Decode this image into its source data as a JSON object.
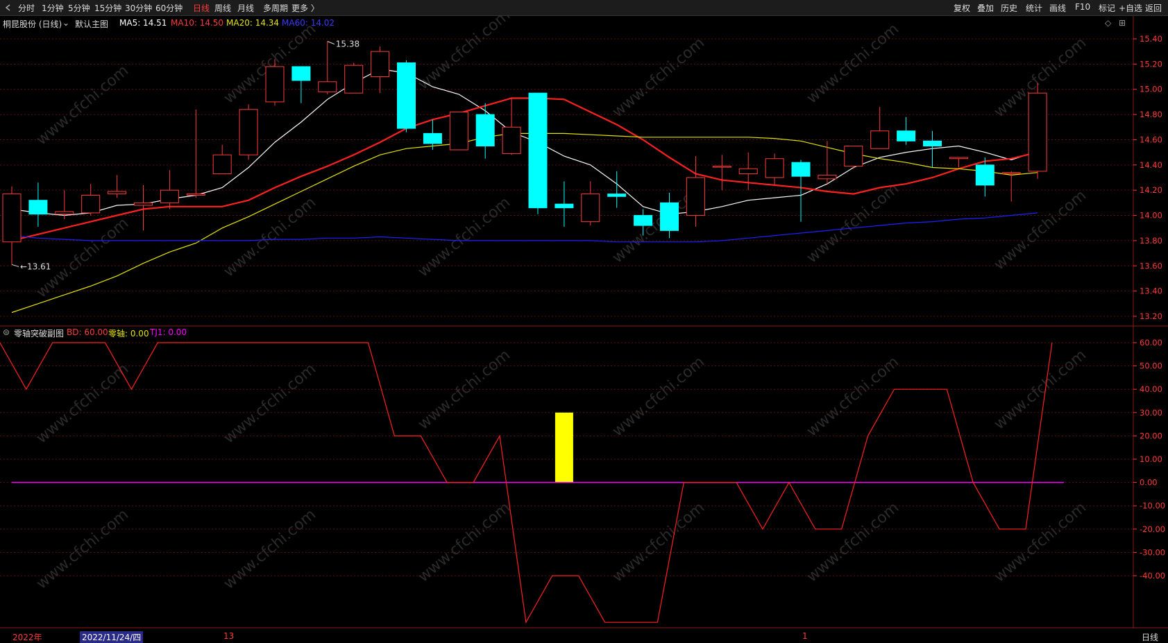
{
  "toolbar": {
    "left_items": [
      {
        "label": "分时",
        "active": false
      },
      {
        "label": "1分钟",
        "active": false
      },
      {
        "label": "5分钟",
        "active": false
      },
      {
        "label": "15分钟",
        "active": false
      },
      {
        "label": "30分钟",
        "active": false
      },
      {
        "label": "60分钟",
        "active": false
      },
      {
        "label": "日线",
        "active": true
      },
      {
        "label": "周线",
        "active": false
      },
      {
        "label": "月线",
        "active": false
      },
      {
        "label": "多周期",
        "active": false
      },
      {
        "label": "更多 〉",
        "active": false
      }
    ],
    "right_items": [
      "复权",
      "叠加",
      "历史",
      "统计",
      "画线",
      "F10",
      "标记",
      "+自选",
      "返回"
    ]
  },
  "main_info": {
    "stock": "桐昆股份 (日线)",
    "template": "默认主图",
    "ma5": "MA5: 14.51",
    "ma10": "MA10: 14.50",
    "ma20": "MA20: 14.34",
    "ma60": "MA60: 14.02"
  },
  "sub_info": {
    "title": "零轴突破副图",
    "bd": "BD: 60.00",
    "zero": "零轴: 0.00",
    "tj1": "TJ1: 0.00"
  },
  "annotations": {
    "high": "15.38",
    "low": "13.61"
  },
  "bottom": {
    "year": "2022年",
    "date": "2022/11/24/四",
    "mark13": "13",
    "mark1": "1",
    "period": "日线"
  },
  "watermark": "www.cfchi.com",
  "colors": {
    "up": "#ff3a3a",
    "down": "#00ffff",
    "ma5": "#ffffff",
    "ma10": "#ff2020",
    "ma20": "#e6e600",
    "ma60": "#2020ff",
    "bd": "#ff2020",
    "bar": "#ffff00",
    "zero": "#ff00ff"
  },
  "chart_data": [
    {
      "type": "candlestick",
      "title": "桐昆股份 (日线)",
      "ylim": [
        13.2,
        15.4
      ],
      "yticks": [
        13.2,
        13.4,
        13.6,
        13.8,
        14.0,
        14.2,
        14.4,
        14.6,
        14.8,
        15.0,
        15.2,
        15.4
      ],
      "candles": [
        {
          "o": 13.79,
          "h": 14.23,
          "l": 13.61,
          "c": 14.17
        },
        {
          "o": 14.12,
          "h": 14.26,
          "l": 13.91,
          "c": 14.01
        },
        {
          "o": 14.01,
          "h": 14.2,
          "l": 13.97,
          "c": 14.03
        },
        {
          "o": 14.02,
          "h": 14.25,
          "l": 14.0,
          "c": 14.16
        },
        {
          "o": 14.17,
          "h": 14.32,
          "l": 14.14,
          "c": 14.19
        },
        {
          "o": 14.08,
          "h": 14.24,
          "l": 13.88,
          "c": 14.1
        },
        {
          "o": 14.1,
          "h": 14.36,
          "l": 14.05,
          "c": 14.2
        },
        {
          "o": 14.16,
          "h": 14.84,
          "l": 14.14,
          "c": 14.17
        },
        {
          "o": 14.33,
          "h": 14.56,
          "l": 14.33,
          "c": 14.48
        },
        {
          "o": 14.48,
          "h": 14.88,
          "l": 14.44,
          "c": 14.84
        },
        {
          "o": 14.9,
          "h": 15.24,
          "l": 14.87,
          "c": 15.18
        },
        {
          "o": 15.18,
          "h": 15.18,
          "l": 14.89,
          "c": 15.07
        },
        {
          "o": 14.98,
          "h": 15.38,
          "l": 14.96,
          "c": 15.06
        },
        {
          "o": 14.97,
          "h": 15.21,
          "l": 14.97,
          "c": 15.19
        },
        {
          "o": 15.1,
          "h": 15.34,
          "l": 14.97,
          "c": 15.3
        },
        {
          "o": 15.21,
          "h": 15.23,
          "l": 14.66,
          "c": 14.69
        },
        {
          "o": 14.65,
          "h": 14.76,
          "l": 14.52,
          "c": 14.57
        },
        {
          "o": 14.52,
          "h": 14.82,
          "l": 14.52,
          "c": 14.82
        },
        {
          "o": 14.8,
          "h": 14.89,
          "l": 14.45,
          "c": 14.55
        },
        {
          "o": 14.49,
          "h": 14.93,
          "l": 14.48,
          "c": 14.7
        },
        {
          "o": 14.97,
          "h": 14.97,
          "l": 14.01,
          "c": 14.06
        },
        {
          "o": 14.09,
          "h": 14.27,
          "l": 13.91,
          "c": 14.06
        },
        {
          "o": 13.95,
          "h": 14.27,
          "l": 13.92,
          "c": 14.17
        },
        {
          "o": 14.17,
          "h": 14.35,
          "l": 14.06,
          "c": 14.15
        },
        {
          "o": 14.0,
          "h": 14.05,
          "l": 13.84,
          "c": 13.92
        },
        {
          "o": 14.1,
          "h": 14.18,
          "l": 13.82,
          "c": 13.88
        },
        {
          "o": 14.0,
          "h": 14.47,
          "l": 13.91,
          "c": 14.3
        },
        {
          "o": 14.39,
          "h": 14.48,
          "l": 14.2,
          "c": 14.39
        },
        {
          "o": 14.33,
          "h": 14.5,
          "l": 14.2,
          "c": 14.37
        },
        {
          "o": 14.3,
          "h": 14.49,
          "l": 14.24,
          "c": 14.45
        },
        {
          "o": 14.42,
          "h": 14.44,
          "l": 13.95,
          "c": 14.31
        },
        {
          "o": 14.29,
          "h": 14.59,
          "l": 14.25,
          "c": 14.32
        },
        {
          "o": 14.39,
          "h": 14.55,
          "l": 14.37,
          "c": 14.55
        },
        {
          "o": 14.53,
          "h": 14.86,
          "l": 14.53,
          "c": 14.67
        },
        {
          "o": 14.67,
          "h": 14.78,
          "l": 14.56,
          "c": 14.59
        },
        {
          "o": 14.59,
          "h": 14.67,
          "l": 14.38,
          "c": 14.55
        },
        {
          "o": 14.45,
          "h": 14.46,
          "l": 14.38,
          "c": 14.46
        },
        {
          "o": 14.4,
          "h": 14.46,
          "l": 14.15,
          "c": 14.24
        },
        {
          "o": 14.34,
          "h": 14.35,
          "l": 14.11,
          "c": 14.34
        },
        {
          "o": 14.35,
          "h": 15.05,
          "l": 14.29,
          "c": 14.97
        }
      ],
      "series": [
        {
          "name": "MA5",
          "values": [
            14.05,
            14.02,
            14.0,
            14.02,
            14.08,
            14.09,
            14.13,
            14.16,
            14.22,
            14.38,
            14.58,
            14.74,
            14.92,
            15.05,
            15.16,
            15.13,
            15.02,
            14.96,
            14.83,
            14.66,
            14.58,
            14.47,
            14.4,
            14.25,
            14.07,
            14.01,
            14.03,
            14.07,
            14.12,
            14.14,
            14.16,
            14.25,
            14.38,
            14.46,
            14.5,
            14.53,
            14.55,
            14.5,
            14.44,
            14.51
          ]
        },
        {
          "name": "MA10",
          "values": [
            13.8,
            13.85,
            13.9,
            13.95,
            14.0,
            14.05,
            14.07,
            14.07,
            14.07,
            14.12,
            14.22,
            14.31,
            14.39,
            14.48,
            14.58,
            14.69,
            14.76,
            14.81,
            14.87,
            14.93,
            14.93,
            14.92,
            14.82,
            14.72,
            14.6,
            14.46,
            14.33,
            14.28,
            14.26,
            14.24,
            14.22,
            14.19,
            14.17,
            14.22,
            14.25,
            14.3,
            14.37,
            14.43,
            14.45,
            14.5
          ]
        },
        {
          "name": "MA20",
          "values": [
            13.23,
            13.3,
            13.37,
            13.44,
            13.52,
            13.62,
            13.71,
            13.78,
            13.9,
            13.99,
            14.09,
            14.19,
            14.29,
            14.39,
            14.48,
            14.53,
            14.55,
            14.57,
            14.62,
            14.65,
            14.65,
            14.65,
            14.64,
            14.63,
            14.62,
            14.62,
            14.62,
            14.62,
            14.62,
            14.61,
            14.59,
            14.54,
            14.49,
            14.45,
            14.42,
            14.38,
            14.37,
            14.35,
            14.32,
            14.34
          ]
        },
        {
          "name": "MA60",
          "values": [
            13.84,
            13.82,
            13.81,
            13.8,
            13.8,
            13.8,
            13.8,
            13.8,
            13.8,
            13.8,
            13.81,
            13.81,
            13.82,
            13.82,
            13.83,
            13.82,
            13.81,
            13.8,
            13.8,
            13.8,
            13.8,
            13.8,
            13.8,
            13.79,
            13.79,
            13.79,
            13.79,
            13.8,
            13.82,
            13.84,
            13.86,
            13.88,
            13.9,
            13.92,
            13.94,
            13.95,
            13.97,
            13.98,
            14.0,
            14.02
          ]
        }
      ]
    },
    {
      "type": "line",
      "title": "零轴突破副图",
      "ylim": [
        -60,
        60
      ],
      "yticks": [
        60,
        50,
        40,
        30,
        20,
        10,
        0,
        -10,
        -20,
        -30,
        -40
      ],
      "series": [
        {
          "name": "BD",
          "values": [
            60,
            40,
            60,
            60,
            60,
            40,
            60,
            60,
            60,
            60,
            60,
            60,
            60,
            60,
            60,
            20,
            20,
            0,
            0,
            20,
            -60,
            -40,
            -40,
            -60,
            -60,
            -60,
            0,
            0,
            0,
            -20,
            0,
            -20,
            -20,
            20,
            40,
            40,
            40,
            0,
            -20,
            -20,
            60
          ]
        },
        {
          "name": "零轴",
          "values": [
            0,
            0,
            0,
            0,
            0,
            0,
            0,
            0,
            0,
            0,
            0,
            0,
            0,
            0,
            0,
            0,
            0,
            0,
            0,
            0,
            0,
            0,
            0,
            0,
            0,
            0,
            0,
            0,
            0,
            0,
            0,
            0,
            0,
            0,
            0,
            0,
            0,
            0,
            0,
            0,
            0
          ]
        },
        {
          "name": "TJ1",
          "values": [
            0,
            0,
            0,
            0,
            0,
            0,
            0,
            0,
            0,
            0,
            0,
            0,
            0,
            0,
            0,
            0,
            0,
            0,
            0,
            0,
            0,
            30,
            0,
            0,
            0,
            0,
            0,
            0,
            0,
            0,
            0,
            0,
            0,
            0,
            0,
            0,
            0,
            0,
            0,
            0,
            0
          ]
        }
      ]
    }
  ]
}
